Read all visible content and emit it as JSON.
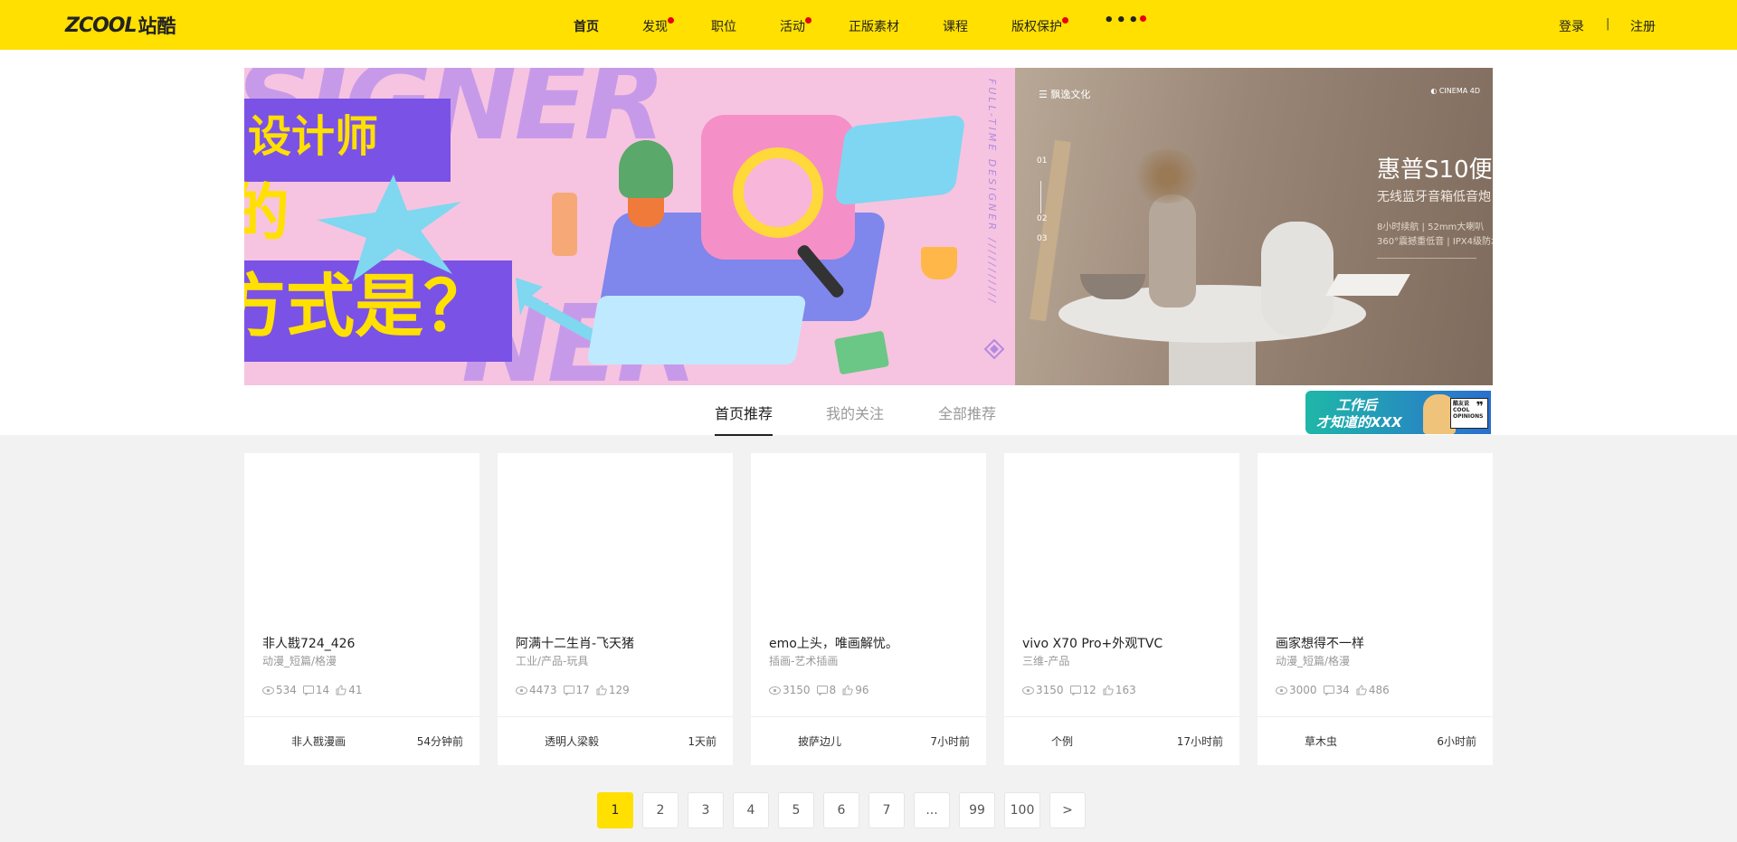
{
  "header": {
    "logo_en": "ZCOOL",
    "logo_cn": "站酷",
    "nav": [
      {
        "label": "首页",
        "active": true,
        "dot": false
      },
      {
        "label": "发现",
        "active": false,
        "dot": true
      },
      {
        "label": "职位",
        "active": false,
        "dot": false
      },
      {
        "label": "活动",
        "active": false,
        "dot": true
      },
      {
        "label": "正版素材",
        "active": false,
        "dot": false
      },
      {
        "label": "课程",
        "active": false,
        "dot": false
      },
      {
        "label": "版权保护",
        "active": false,
        "dot": true
      },
      {
        "label": "•••",
        "active": false,
        "dot": true
      }
    ],
    "login": "登录",
    "separator": "|",
    "register": "注册",
    "accent_color": "#ffe000",
    "dot_color": "#e60012"
  },
  "banner_left": {
    "big_text_1": "SIGNER",
    "big_text_2": "NER",
    "line1": "设计师",
    "line2": "的",
    "line3": "方式是？",
    "side_text": "FULL-TIME DESIGNER ///////////"
  },
  "banner_right": {
    "brand": "飘逸文化",
    "logo": "CINEMA 4D",
    "index_1": "01",
    "index_2": "02",
    "index_3": "03",
    "title": "惠普S10便",
    "subtitle": "无线蓝牙音箱低音炮",
    "small_1": "8小时续航 | 52mm大喇叭",
    "small_2": "360°震撼重低音 | IPX4级防水"
  },
  "tabs": [
    {
      "label": "首页推荐",
      "active": true
    },
    {
      "label": "我的关注",
      "active": false
    },
    {
      "label": "全部推荐",
      "active": false
    }
  ],
  "ad": {
    "line1": "工作后",
    "line2": "才知道的XXX",
    "badge_top": "酷友说",
    "badge_text": "COOL OPINIONS",
    "badge_quote": "❞"
  },
  "cards": [
    {
      "title": "非人戡724_426",
      "category": "动漫_短篇/格漫",
      "views": "534",
      "comments": "14",
      "likes": "41",
      "author": "非人戡漫画",
      "time": "54分钟前"
    },
    {
      "title": "阿满十二生肖-飞天猪",
      "category": "工业/产品-玩具",
      "views": "4473",
      "comments": "17",
      "likes": "129",
      "author": "透明人梁毅",
      "time": "1天前"
    },
    {
      "title": "emo上头，唯画解忧。",
      "category": "插画-艺术插画",
      "views": "3150",
      "comments": "8",
      "likes": "96",
      "author": "披萨边儿",
      "time": "7小时前"
    },
    {
      "title": "vivo X70 Pro+外观TVC",
      "category": "三维-产品",
      "views": "3150",
      "comments": "12",
      "likes": "163",
      "author": "个例",
      "time": "17小时前"
    },
    {
      "title": "画家想得不一样",
      "category": "动漫_短篇/格漫",
      "views": "3000",
      "comments": "34",
      "likes": "486",
      "author": "草木虫",
      "time": "6小时前"
    }
  ],
  "pagination": [
    "1",
    "2",
    "3",
    "4",
    "5",
    "6",
    "7",
    "...",
    "99",
    "100",
    ">"
  ],
  "pagination_active": "1"
}
